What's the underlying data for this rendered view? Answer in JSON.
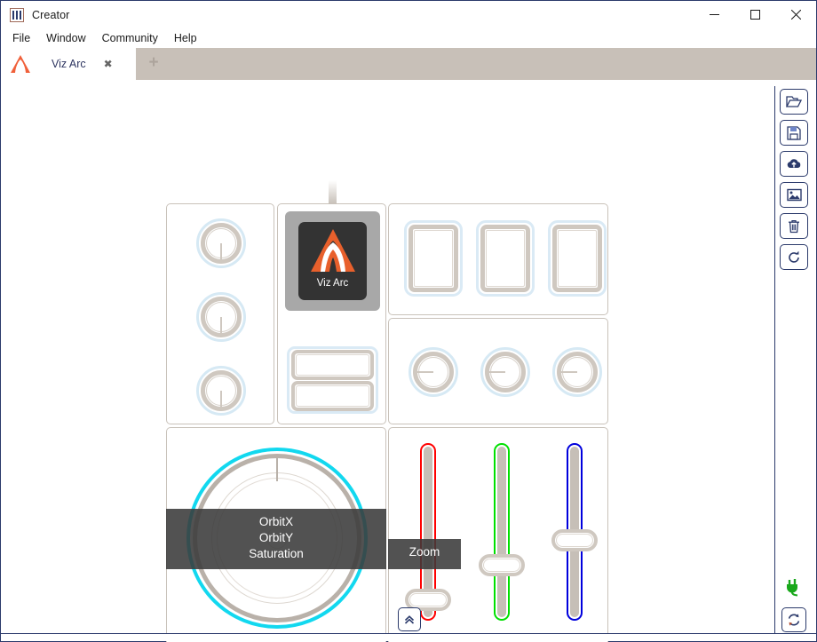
{
  "window": {
    "title": "Creator",
    "icon": "app-bars-icon",
    "controls": {
      "minimize": "minimize-icon",
      "maximize": "maximize-icon",
      "close": "close-icon"
    }
  },
  "menubar": {
    "items": [
      {
        "label": "File"
      },
      {
        "label": "Window"
      },
      {
        "label": "Community"
      },
      {
        "label": "Help"
      }
    ]
  },
  "tabs": {
    "active": {
      "label": "Viz Arc",
      "close": "×"
    },
    "add_label": "+"
  },
  "panels": {
    "knobs_left": {
      "knobs": [
        {
          "name": "knob-1",
          "direction": "down"
        },
        {
          "name": "knob-2",
          "direction": "down"
        },
        {
          "name": "knob-3",
          "direction": "down"
        }
      ]
    },
    "tile_group": {
      "tile": {
        "label": "Viz Arc",
        "icon": "viz-arc-logo"
      },
      "double_button": {
        "top_label": "",
        "bottom_label": ""
      }
    },
    "buttons_row": {
      "buttons": [
        {
          "name": "rect-button-1",
          "label": ""
        },
        {
          "name": "rect-button-2",
          "label": ""
        },
        {
          "name": "rect-button-3",
          "label": ""
        }
      ]
    },
    "knobs_row": {
      "knobs": [
        {
          "name": "knob-4",
          "direction": "left"
        },
        {
          "name": "knob-5",
          "direction": "left"
        },
        {
          "name": "knob-6",
          "direction": "left"
        }
      ]
    },
    "trackball": {
      "name": "trackball-control",
      "ring_color": "#12d8ef",
      "tooltip_lines": [
        "OrbitX",
        "OrbitY",
        "Saturation"
      ]
    },
    "sliders": {
      "items": [
        {
          "name": "slider-red",
          "color": "#ff0000",
          "handle_pct": 92,
          "tooltip": "Zoom"
        },
        {
          "name": "slider-green",
          "color": "#00e000",
          "handle_pct": 70,
          "tooltip": ""
        },
        {
          "name": "slider-blue",
          "color": "#0000dd",
          "handle_pct": 42,
          "tooltip": ""
        }
      ]
    }
  },
  "toolbar_right": {
    "buttons": [
      {
        "name": "open-button",
        "icon": "folder-open-icon"
      },
      {
        "name": "save-button",
        "icon": "floppy-save-icon"
      },
      {
        "name": "upload-button",
        "icon": "cloud-upload-icon"
      },
      {
        "name": "image-button",
        "icon": "image-icon"
      },
      {
        "name": "delete-button",
        "icon": "trash-icon"
      },
      {
        "name": "refresh-button",
        "icon": "refresh-icon"
      }
    ]
  },
  "footer": {
    "collapse_button": {
      "name": "collapse-panel-button",
      "icon": "chevron-double-up-icon"
    },
    "connection": {
      "name": "connection-status",
      "icon": "plug-connected-icon",
      "color": "#19a81b"
    },
    "sync_button": {
      "name": "sync-button",
      "icon": "sync-icon"
    }
  },
  "theme": {
    "tabstrip_bg": "#c8c0b8",
    "panel_border": "#c9c2ba",
    "knob_ring": "#cfc8c0",
    "knob_glow": "#d6e9f4",
    "accent_blue": "#2b3a6b",
    "tile_bg": "#333333",
    "logo_orange": "#e8602c"
  }
}
